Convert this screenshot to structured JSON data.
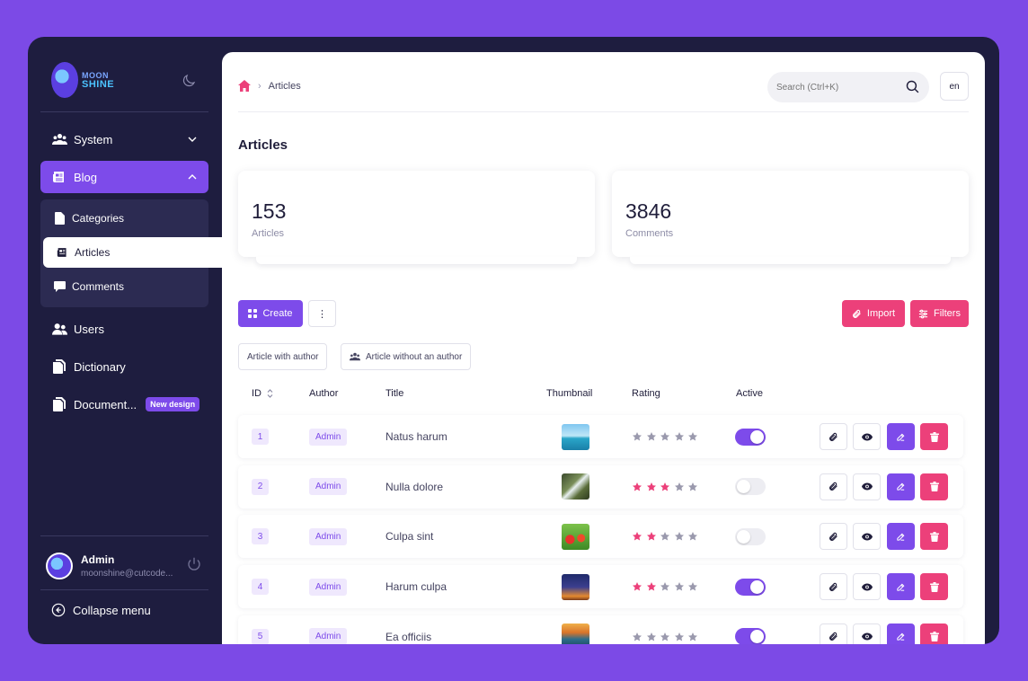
{
  "brand": {
    "line1": "MOON",
    "line2": "SHINE"
  },
  "sidebar": {
    "system_label": "System",
    "blog_label": "Blog",
    "sub": {
      "categories": "Categories",
      "articles": "Articles",
      "comments": "Comments"
    },
    "users_label": "Users",
    "dictionary_label": "Dictionary",
    "documents_label": "Document...",
    "new_badge": "New design",
    "user": {
      "name": "Admin",
      "email": "moonshine@cutcode..."
    },
    "collapse_label": "Collapse menu"
  },
  "header": {
    "breadcrumb_current": "Articles",
    "search_placeholder": "Search (Ctrl+K)",
    "lang": "en"
  },
  "page": {
    "title": "Articles"
  },
  "metrics": [
    {
      "value": "153",
      "label": "Articles"
    },
    {
      "value": "3846",
      "label": "Comments"
    }
  ],
  "actions": {
    "create": "Create",
    "more": "⋮",
    "import": "Import",
    "filters": "Filters"
  },
  "quick_filters": [
    "Article with author",
    "Article without an author"
  ],
  "table": {
    "columns": {
      "id": "ID",
      "author": "Author",
      "title": "Title",
      "thumbnail": "Thumbnail",
      "rating": "Rating",
      "active": "Active"
    },
    "rows": [
      {
        "id": "1",
        "author": "Admin",
        "title": "Natus harum",
        "rating": 0,
        "active": true,
        "thumb": "beach"
      },
      {
        "id": "2",
        "author": "Admin",
        "title": "Nulla dolore",
        "rating": 3,
        "active": false,
        "thumb": "waterfall"
      },
      {
        "id": "3",
        "author": "Admin",
        "title": "Culpa sint",
        "rating": 2,
        "active": false,
        "thumb": "flowers"
      },
      {
        "id": "4",
        "author": "Admin",
        "title": "Harum culpa",
        "rating": 2,
        "active": true,
        "thumb": "tower"
      },
      {
        "id": "5",
        "author": "Admin",
        "title": "Ea officiis",
        "rating": 0,
        "active": true,
        "thumb": "mountains"
      }
    ]
  },
  "colors": {
    "accent": "#7d4bea",
    "danger": "#ec407a",
    "sidebar": "#1e1d3f",
    "background": "#7c4ae6",
    "star_on": "#ec407a",
    "star_off": "#9a99ad"
  }
}
